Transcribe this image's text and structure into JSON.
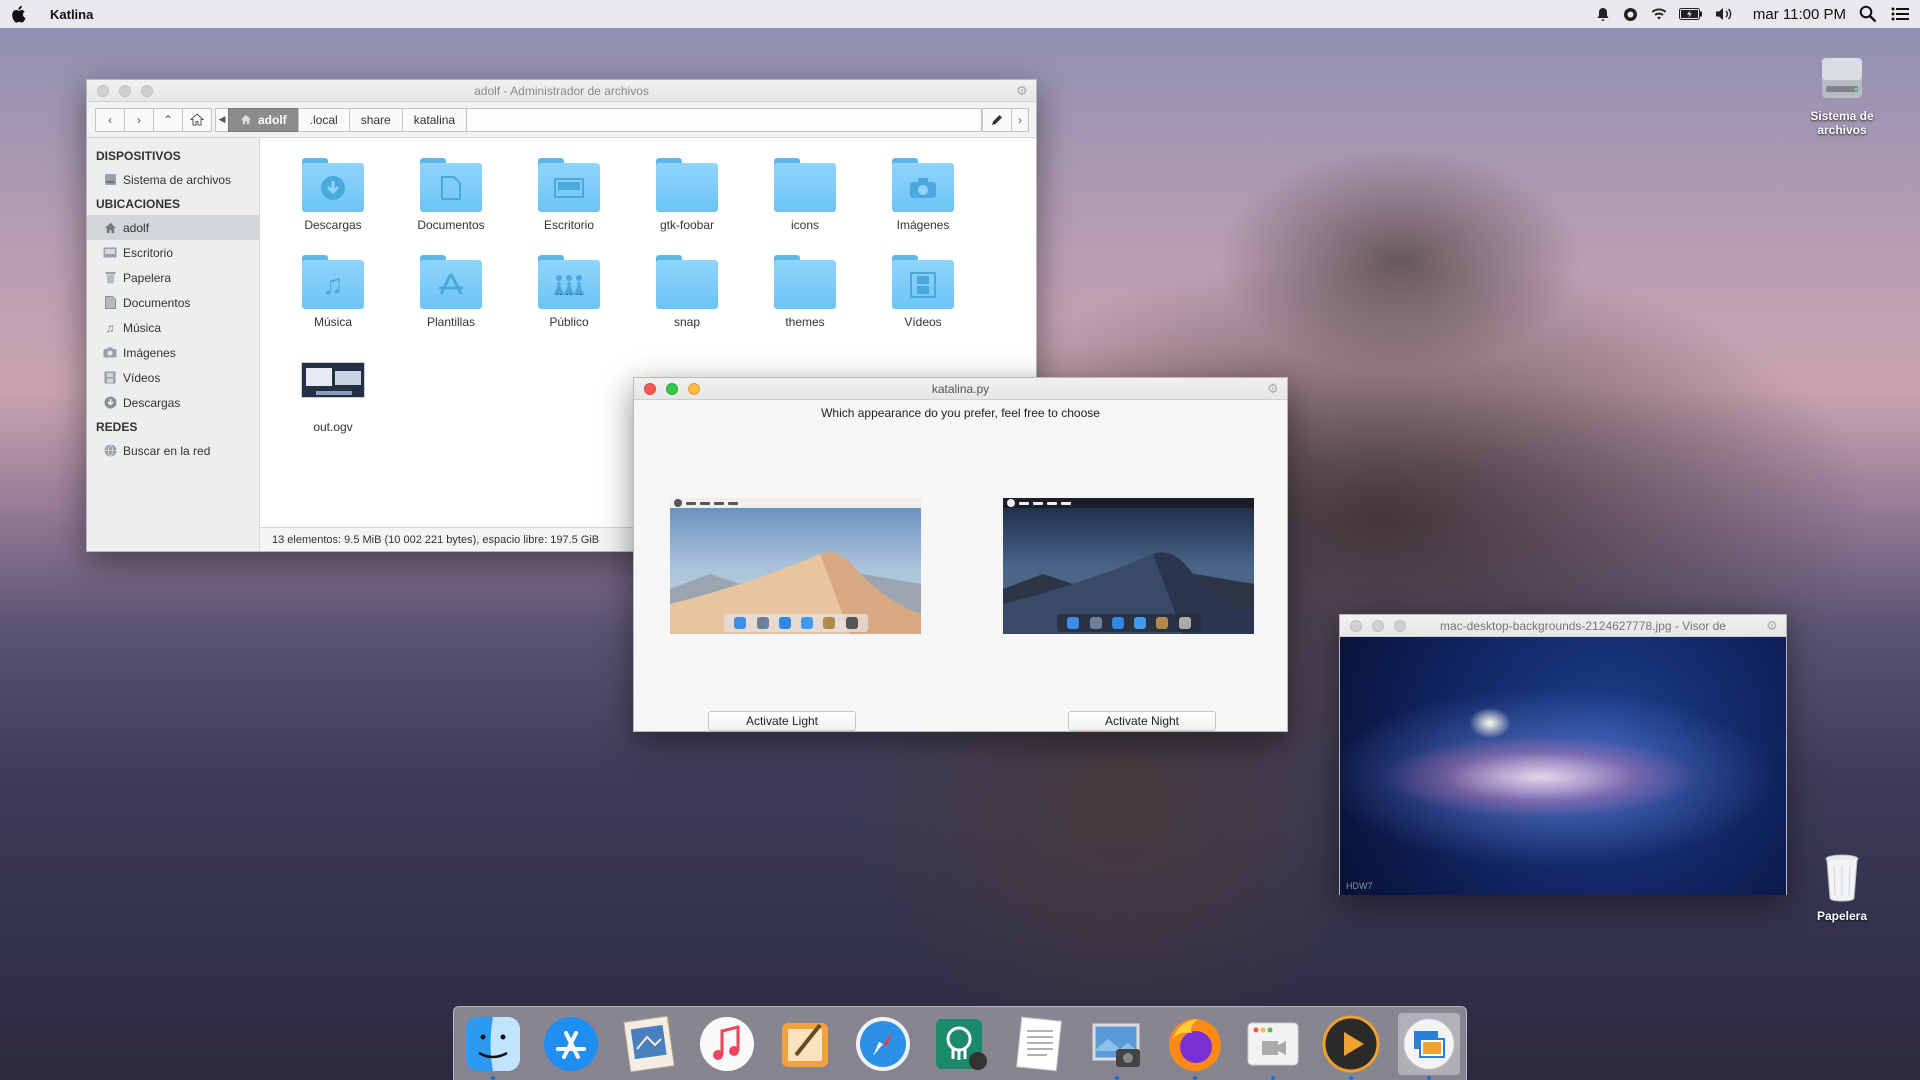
{
  "menubar": {
    "app_name": "Katlina",
    "clock": "mar 11:00 PM",
    "tray_icons": [
      "bell-icon",
      "record-icon",
      "wifi-icon",
      "battery-icon",
      "volume-icon"
    ]
  },
  "desktop": {
    "icons": [
      {
        "label": "Sistema de archivos",
        "icon": "hard-drive-icon"
      },
      {
        "label": "Papelera",
        "icon": "trash-icon"
      }
    ]
  },
  "file_manager": {
    "title": "adolf - Administrador de archivos",
    "breadcrumbs": [
      "adolf",
      ".local",
      "share",
      "katalina"
    ],
    "sidebar": {
      "sections": [
        {
          "heading": "DISPOSITIVOS",
          "items": [
            {
              "label": "Sistema de archivos",
              "icon": "hard-drive-icon"
            }
          ]
        },
        {
          "heading": "UBICACIONES",
          "items": [
            {
              "label": "adolf",
              "icon": "home-icon",
              "selected": true
            },
            {
              "label": "Escritorio",
              "icon": "desktop-icon"
            },
            {
              "label": "Papelera",
              "icon": "trash-icon"
            },
            {
              "label": "Documentos",
              "icon": "document-icon"
            },
            {
              "label": "Música",
              "icon": "music-icon"
            },
            {
              "label": "Imágenes",
              "icon": "camera-icon"
            },
            {
              "label": "Vídeos",
              "icon": "film-icon"
            },
            {
              "label": "Descargas",
              "icon": "download-icon"
            }
          ]
        },
        {
          "heading": "REDES",
          "items": [
            {
              "label": "Buscar en la red",
              "icon": "network-icon"
            }
          ]
        }
      ]
    },
    "files": [
      {
        "name": "Descargas",
        "glyph": "download-icon"
      },
      {
        "name": "Documentos",
        "glyph": "document-icon"
      },
      {
        "name": "Escritorio",
        "glyph": "desktop-icon"
      },
      {
        "name": "gtk-foobar",
        "glyph": ""
      },
      {
        "name": "icons",
        "glyph": ""
      },
      {
        "name": "Imágenes",
        "glyph": "camera-icon"
      },
      {
        "name": "Música",
        "glyph": "music-icon"
      },
      {
        "name": "Plantillas",
        "glyph": "template-icon"
      },
      {
        "name": "Público",
        "glyph": "people-icon"
      },
      {
        "name": "snap",
        "glyph": ""
      },
      {
        "name": "themes",
        "glyph": ""
      },
      {
        "name": "Vídeos",
        "glyph": "film-icon"
      },
      {
        "name": "out.ogv",
        "glyph": "video-thumbnail"
      }
    ],
    "status": "13 elementos: 9.5 MiB (10 002 221 bytes), espacio libre: 197.5 GiB"
  },
  "katalina": {
    "title": "katalina.py",
    "question": "Which appearance do you prefer, feel free to choose",
    "light_button": "Activate Light",
    "night_button": "Activate Night"
  },
  "image_viewer": {
    "title": "mac-desktop-backgrounds-2124627778.jpg - Visor de",
    "watermark": "HDW7"
  },
  "dock": {
    "apps": [
      "finder-icon",
      "app-store-icon",
      "mail-icon",
      "music-icon",
      "pages-icon",
      "safari-icon",
      "gitkraken-icon",
      "textedit-icon",
      "image-capture-icon",
      "firefox-icon",
      "photo-booth-icon",
      "media-player-icon",
      "image-viewer-icon"
    ]
  },
  "colors": {
    "close": "#fc5753",
    "minimize": "#fdbc40",
    "maximize": "#33c748",
    "folder": "#7ccbf7",
    "selection": "#8b8b8b"
  }
}
